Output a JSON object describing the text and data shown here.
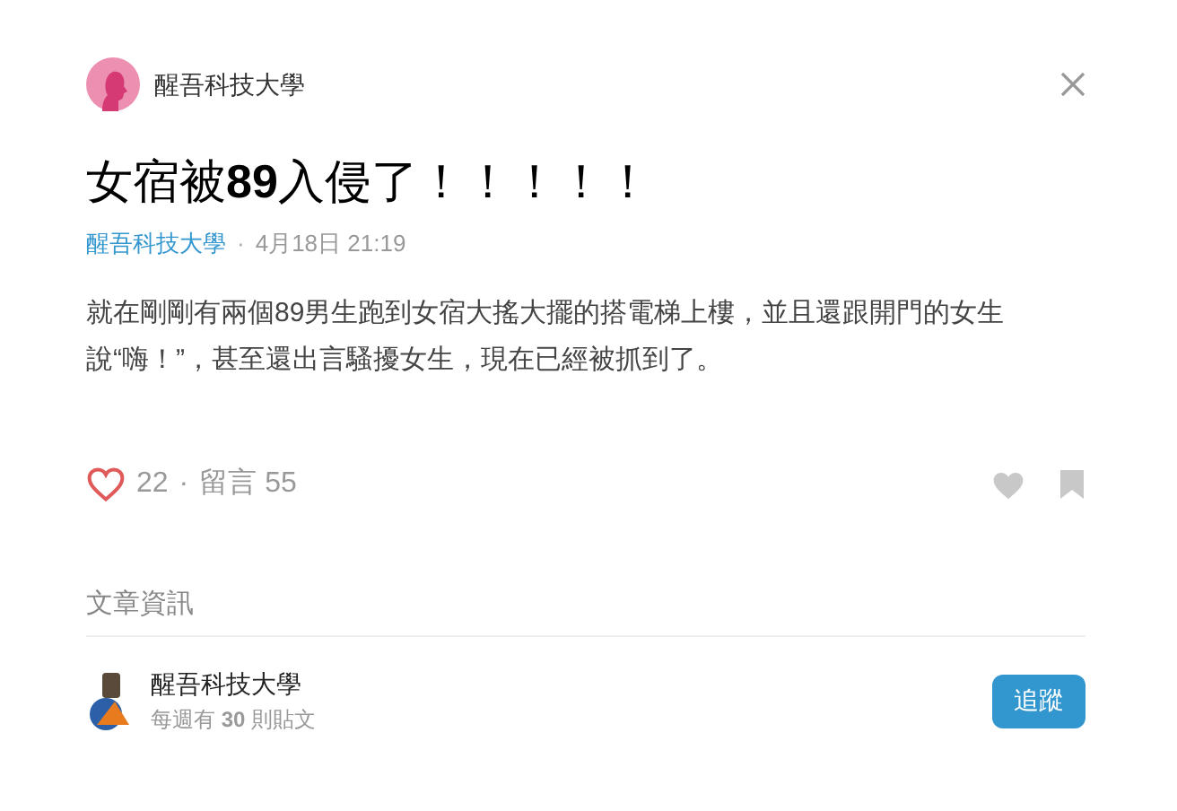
{
  "header": {
    "forum": "醒吾科技大學"
  },
  "post": {
    "title": "女宿被**89**入侵了！！！！！",
    "forum": "醒吾科技大學",
    "separator": "·",
    "time": "4月18日 21:19",
    "body": "就在剛剛有兩個89男生跑到女宿大搖大擺的搭電梯上樓，並且還跟開門的女生說“嗨！”，甚至還出言騷擾女生，現在已經被抓到了。"
  },
  "reactions": {
    "likes": "22",
    "separator": "·",
    "comments": "留言 55",
    "liked": false,
    "saved": false
  },
  "info": {
    "heading": "文章資訊",
    "forum": "醒吾科技大學",
    "weekly": "每週有 **30** 則貼文",
    "follow": "追蹤"
  }
}
